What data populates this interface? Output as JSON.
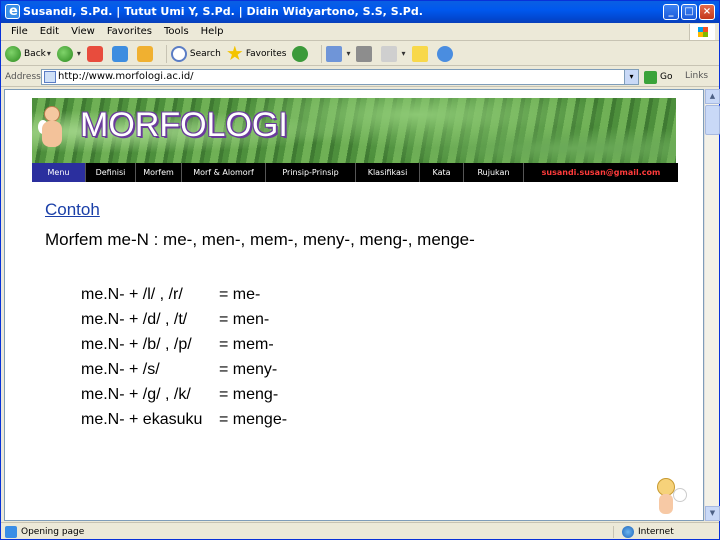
{
  "window": {
    "title": "Susandi, S.Pd. | Tutut Umi Y, S.Pd. | Didin Widyartono, S.S, S.Pd."
  },
  "menubar": [
    "File",
    "Edit",
    "View",
    "Favorites",
    "Tools",
    "Help"
  ],
  "toolbar": {
    "back": "Back",
    "search": "Search",
    "favorites": "Favorites"
  },
  "address": {
    "label": "Address",
    "url": "http://www.morfologi.ac.id/",
    "go": "Go",
    "links": "Links"
  },
  "banner": {
    "title": "MORFOLOGI"
  },
  "nav": {
    "items": [
      "Menu",
      "Definisi",
      "Morfem",
      "Morf & Alomorf",
      "Prinsip-Prinsip",
      "Klasifikasi",
      "Kata",
      "Rujukan"
    ],
    "email": "susandi.susan@gmail.com"
  },
  "content": {
    "link": "Contoh",
    "line": "Morfem me-N : me-, men-, mem-, meny-, meng-, menge-",
    "rules": [
      {
        "lhs": "me.N- + /l/ , /r/",
        "rhs": "= me-"
      },
      {
        "lhs": "me.N- + /d/ , /t/",
        "rhs": "= men-"
      },
      {
        "lhs": "me.N- + /b/ , /p/",
        "rhs": "= mem-"
      },
      {
        "lhs": "me.N- + /s/",
        "rhs": "= meny-"
      },
      {
        "lhs": "me.N- + /g/ , /k/",
        "rhs": "= meng-"
      },
      {
        "lhs": "me.N- + ekasuku",
        "rhs": "= menge-"
      }
    ]
  },
  "status": {
    "left": "Opening page",
    "right": "Internet"
  }
}
